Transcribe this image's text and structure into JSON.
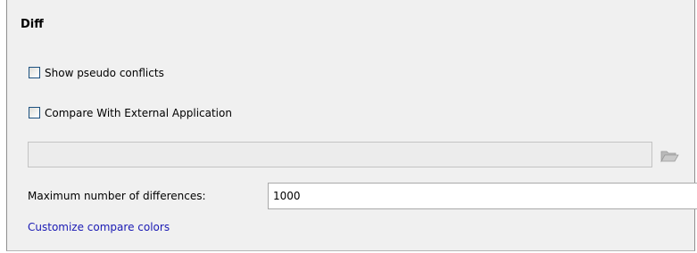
{
  "section": {
    "title": "Diff"
  },
  "options": {
    "show_pseudo_conflicts": {
      "label": "Show pseudo conflicts",
      "checked": false
    },
    "compare_external": {
      "label": "Compare With External Application",
      "checked": false
    }
  },
  "external_app": {
    "path_value": "",
    "browse_icon": "folder-icon"
  },
  "max_differences": {
    "label": "Maximum number of differences:",
    "value": "1000"
  },
  "links": {
    "customize_colors": "Customize compare colors"
  },
  "colors": {
    "link": "#1a1ab4",
    "panel_bg": "#f0f0f0",
    "checkbox_border": "#1c5180"
  }
}
